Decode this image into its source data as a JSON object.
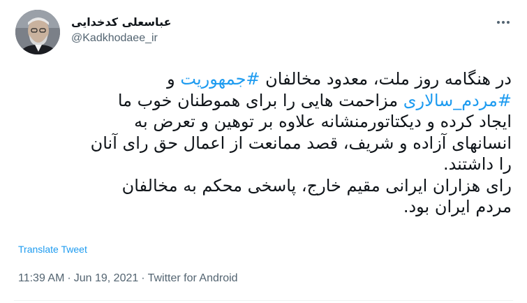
{
  "user": {
    "display_name": "عباسعلی کدخدایی",
    "handle": "@Kadkhodaee_ir"
  },
  "tweet": {
    "seg1": "در هنگامه روز ملت، معدود مخالفان ",
    "hashtag1": "#جمهوریت",
    "seg2": " و\n",
    "hashtag2": "#مردم_سالاری",
    "seg3": " مزاحمت هایی را برای هموطنان خوب ما\nایجاد کرده و دیکتاتورمنشانه علاوه بر توهین و تعرض به\nانسانهای آزاده و شریف، قصد ممانعت از اعمال حق رای آنان\nرا داشتند.\nرای هزاران ایرانی مقیم خارج، پاسخی محکم به مخالفان\nمردم ایران بود."
  },
  "translate_label": "Translate Tweet",
  "meta": {
    "time": "11:39 AM",
    "separator": "·",
    "date": "Jun 19, 2021",
    "source": "Twitter for Android"
  },
  "colors": {
    "accent": "#1d9bf0",
    "text": "#0f1419",
    "secondary": "#536471"
  },
  "icons": {
    "more": "more-dots-icon"
  }
}
